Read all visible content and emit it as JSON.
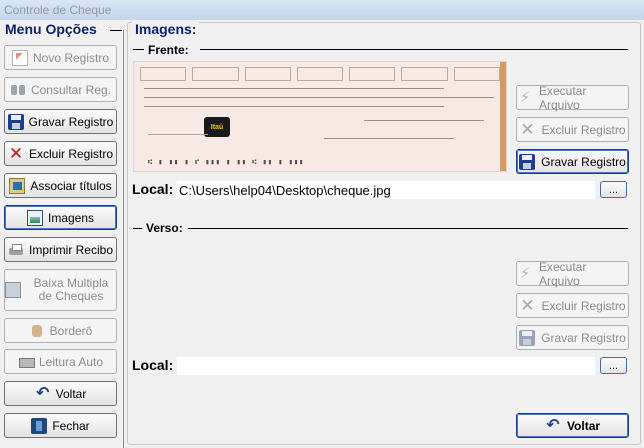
{
  "window": {
    "title": "Controle de Cheque"
  },
  "menu": {
    "title": "Menu Opções",
    "items": [
      {
        "label": "Novo Registro",
        "icon": "new-document-icon",
        "enabled": false
      },
      {
        "label": "Consultar Reg.",
        "icon": "binoculars-icon",
        "enabled": false
      },
      {
        "label": "Gravar Registro",
        "icon": "floppy-disk-icon",
        "enabled": true
      },
      {
        "label": "Excluir Registro",
        "icon": "delete-x-icon",
        "enabled": true
      },
      {
        "label": "Associar títulos",
        "icon": "associate-icon",
        "enabled": true
      },
      {
        "label": "Imagens",
        "icon": "image-icon",
        "enabled": true
      },
      {
        "label": "Imprimir Recibo",
        "icon": "printer-icon",
        "enabled": true
      },
      {
        "label": "Baixa Multipla de Cheques",
        "icon": "batch-icon",
        "enabled": false
      },
      {
        "label": "Borderô",
        "icon": "bordero-icon",
        "enabled": false
      },
      {
        "label": "Leitura Auto",
        "icon": "scanner-icon",
        "enabled": false
      },
      {
        "label": "Voltar",
        "icon": "back-arrow-icon",
        "enabled": true
      },
      {
        "label": "Fechar",
        "icon": "exit-door-icon",
        "enabled": true
      }
    ]
  },
  "images": {
    "title": "Imagens:",
    "front": {
      "title": "Frente:",
      "buttons": {
        "execute": "Executar Arquivo",
        "delete": "Excluir Registro",
        "save": "Gravar Registro"
      },
      "local_label": "Local:",
      "local_value": "C:\\Users\\help04\\Desktop\\cheque.jpg",
      "browse": "...",
      "cheque": {
        "bank": "Itaú"
      }
    },
    "back": {
      "title": "Verso:",
      "buttons": {
        "execute": "Executar Arquivo",
        "delete": "Excluir Registro",
        "save": "Gravar Registro"
      },
      "local_label": "Local:",
      "local_value": "",
      "browse": "..."
    },
    "return_button": "Voltar"
  }
}
